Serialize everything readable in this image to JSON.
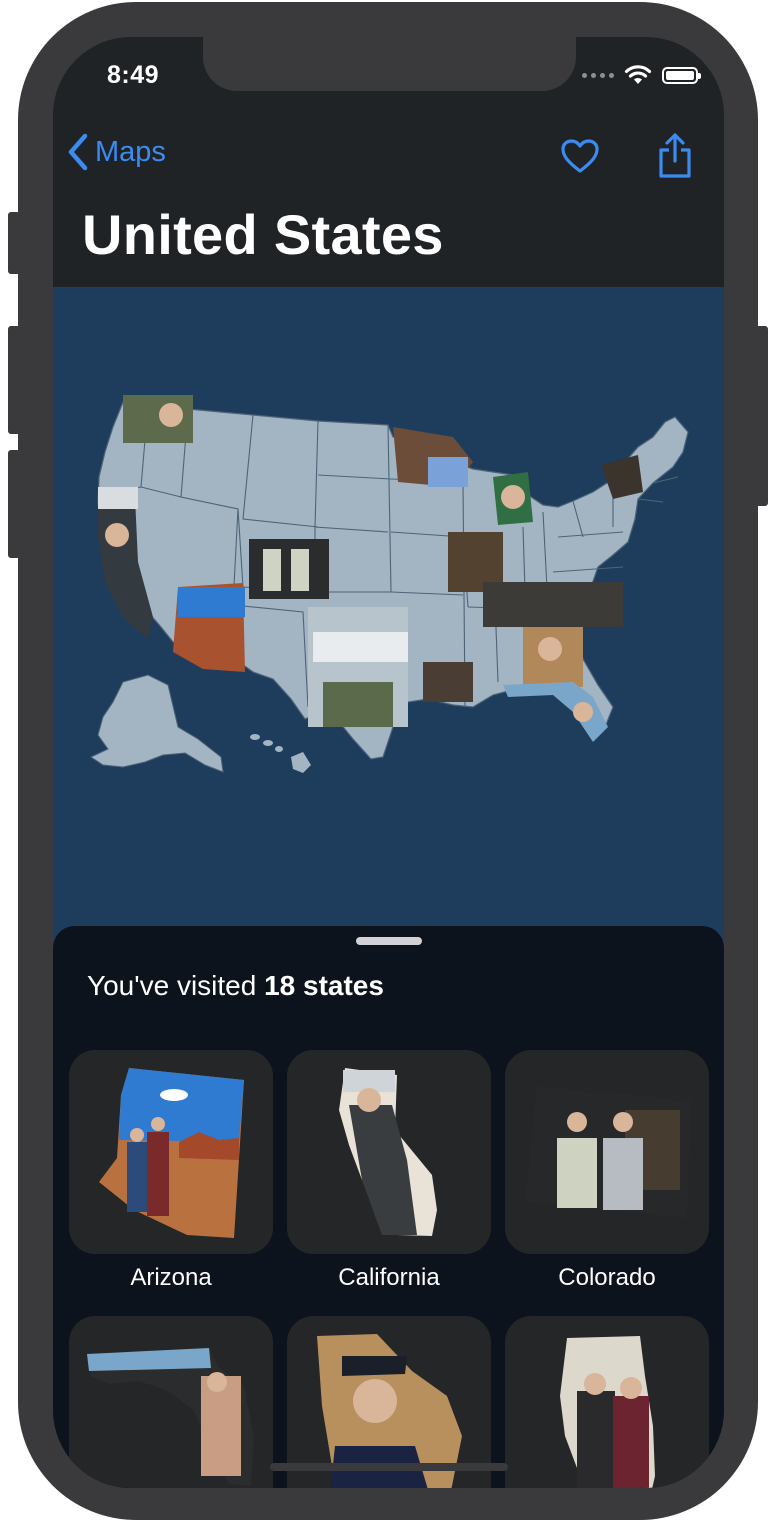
{
  "status": {
    "time": "8:49"
  },
  "nav": {
    "back_label": "Maps"
  },
  "title": "United States",
  "summary": {
    "prefix": "You've visited ",
    "count_text": "18 states"
  },
  "states": [
    {
      "label": "Arizona"
    },
    {
      "label": "California"
    },
    {
      "label": "Colorado"
    },
    {
      "label": ""
    },
    {
      "label": ""
    },
    {
      "label": ""
    }
  ],
  "colors": {
    "accent": "#3b8cf0",
    "map_background": "#1e3d5d",
    "state_fill": "#a3b5c3",
    "sheet_background": "#0c131c",
    "tile_background": "#252628"
  }
}
